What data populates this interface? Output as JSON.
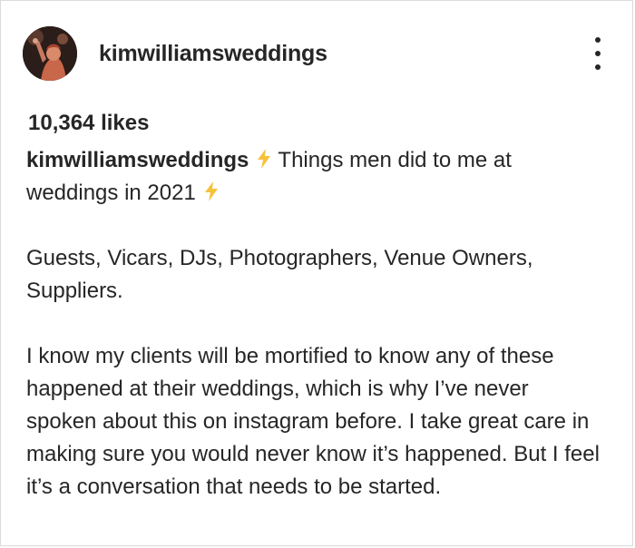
{
  "post": {
    "username": "kimwilliamsweddings",
    "likes": "10,364 likes",
    "caption": {
      "username": "kimwilliamsweddings",
      "line1_text": "Things men did to me at",
      "line2_text": "weddings in 2021",
      "paragraph2": "Guests, Vicars, DJs, Photographers, Venue Owners, Suppliers.",
      "paragraph3": "I know my clients will be mortified to know any of these happened at their weddings, which is why I’ve never spoken about this on instagram before. I take great care in making sure you would never know it’s happened. But I feel it’s a conversation that needs to be started."
    }
  },
  "icons": {
    "more": "more-options-icon",
    "emoji": "lightning-bolt-emoji"
  },
  "colors": {
    "text": "#262626",
    "bolt": "#f5c23a"
  }
}
